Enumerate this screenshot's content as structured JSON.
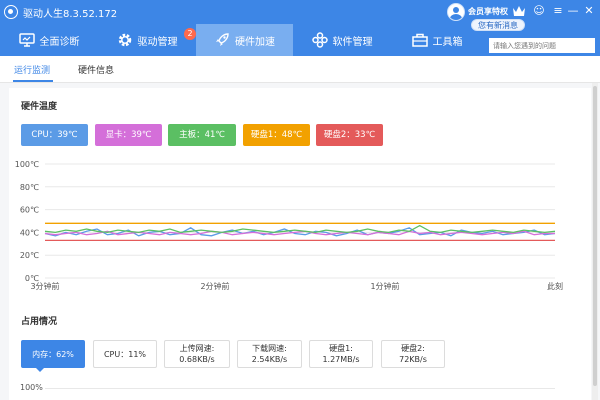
{
  "titlebar": {
    "title": "驱动人生8.3.52.172",
    "vip": "会员享特权",
    "message_badge": "您有新消息",
    "buttons": [
      "☺",
      "≡",
      "—",
      "✕"
    ]
  },
  "nav": {
    "tabs": [
      {
        "label": "全面诊断",
        "icon": "monitor-icon",
        "active": false
      },
      {
        "label": "驱动管理",
        "icon": "gear-icon",
        "active": false
      },
      {
        "label": "硬件加速",
        "icon": "rocket-icon",
        "active": true
      },
      {
        "label": "软件管理",
        "icon": "apps-icon",
        "active": false
      },
      {
        "label": "工具箱",
        "icon": "toolbox-icon",
        "active": false
      }
    ],
    "driver_badge": "2",
    "search_placeholder": "请输入您遇到的问题"
  },
  "subtabs": [
    "运行监测",
    "硬件信息"
  ],
  "temperature": {
    "title": "硬件温度",
    "chips": [
      {
        "label": "CPU：39℃",
        "color": "#5b9be6"
      },
      {
        "label": "显卡：39℃",
        "color": "#d46fd9"
      },
      {
        "label": "主板：41℃",
        "color": "#5bbf63"
      },
      {
        "label": "硬盘1：48℃",
        "color": "#f2a100"
      },
      {
        "label": "硬盘2：33℃",
        "color": "#e45a5a"
      }
    ]
  },
  "chart_data": {
    "type": "line",
    "ylabels": [
      "100℃",
      "80℃",
      "60℃",
      "40℃",
      "20℃",
      "0℃"
    ],
    "xlabels": [
      "3分钟前",
      "2分钟前",
      "1分钟前",
      "此刻"
    ],
    "ylim": [
      0,
      100
    ],
    "grid": true,
    "series": [
      {
        "name": "CPU",
        "color": "#5b9be6",
        "values": [
          39,
          37,
          40,
          38,
          41,
          43,
          38,
          39,
          42,
          37,
          40,
          41,
          38,
          39,
          44,
          38,
          37,
          40,
          42,
          39,
          41,
          38,
          40,
          43,
          39,
          38,
          41,
          40,
          37,
          39,
          42,
          38,
          40,
          39,
          41,
          44,
          38,
          39,
          40,
          37,
          42,
          40,
          39,
          41,
          38,
          39,
          40,
          42,
          38,
          39
        ]
      },
      {
        "name": "显卡",
        "color": "#d46fd9",
        "values": [
          39,
          38,
          39,
          40,
          38,
          39,
          41,
          38,
          39,
          40,
          39,
          38,
          40,
          39,
          38,
          39,
          41,
          40,
          38,
          39,
          40,
          39,
          38,
          39,
          40,
          41,
          39,
          38,
          39,
          40,
          39,
          38,
          40,
          39,
          38,
          41,
          39,
          40,
          38,
          39,
          40,
          39,
          38,
          39,
          40,
          39,
          41,
          38,
          39,
          39
        ]
      },
      {
        "name": "主板",
        "color": "#5bbf63",
        "values": [
          41,
          40,
          42,
          41,
          43,
          41,
          40,
          42,
          41,
          40,
          42,
          41,
          43,
          40,
          41,
          42,
          41,
          40,
          41,
          43,
          42,
          41,
          40,
          41,
          42,
          41,
          40,
          42,
          41,
          40,
          41,
          43,
          41,
          40,
          42,
          41,
          46,
          41,
          40,
          42,
          41,
          40,
          41,
          42,
          41,
          40,
          42,
          41,
          40,
          41
        ]
      },
      {
        "name": "硬盘1",
        "color": "#f2a100",
        "values": [
          48,
          48,
          48,
          48,
          48,
          48,
          48,
          48,
          48,
          48,
          48,
          48,
          48,
          48,
          48,
          48,
          48,
          48,
          48,
          48,
          48,
          48,
          48,
          48,
          48,
          48,
          48,
          48,
          48,
          48,
          48,
          48,
          48,
          48,
          48,
          48,
          48,
          48,
          48,
          48,
          48,
          48,
          48,
          48,
          48,
          48,
          48,
          48,
          48,
          48
        ]
      },
      {
        "name": "硬盘2",
        "color": "#e45a5a",
        "values": [
          33,
          33,
          33,
          33,
          33,
          33,
          33,
          33,
          33,
          33,
          33,
          33,
          33,
          33,
          33,
          33,
          33,
          33,
          33,
          33,
          33,
          33,
          33,
          33,
          33,
          33,
          33,
          33,
          33,
          33,
          33,
          33,
          33,
          33,
          33,
          33,
          33,
          33,
          33,
          33,
          33,
          33,
          33,
          33,
          33,
          33,
          33,
          33,
          33,
          33
        ]
      }
    ]
  },
  "usage": {
    "title": "占用情况",
    "cards": [
      {
        "label": "内存：62%",
        "active": true
      },
      {
        "label": "CPU：11%",
        "active": false
      },
      {
        "label": "上传网速:",
        "value": "0.68KB/s",
        "active": false
      },
      {
        "label": "下载网速:",
        "value": "2.54KB/s",
        "active": false
      },
      {
        "label": "硬盘1:",
        "value": "1.27MB/s",
        "active": false
      },
      {
        "label": "硬盘2:",
        "value": "72KB/s",
        "active": false
      }
    ],
    "axis_label": "100%"
  }
}
